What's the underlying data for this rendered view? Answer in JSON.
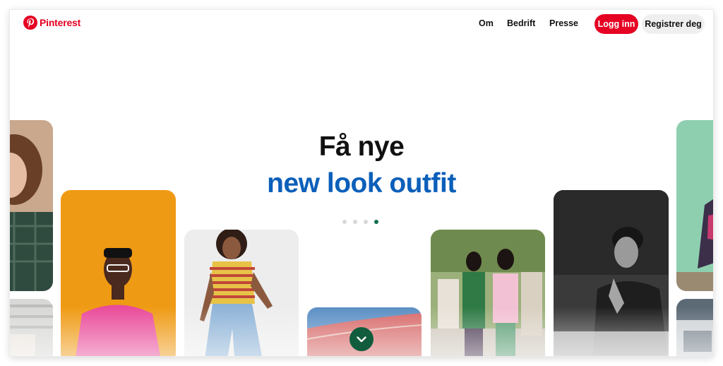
{
  "header": {
    "brand": "Pinterest",
    "nav": [
      "Om",
      "Bedrift",
      "Presse"
    ],
    "login_label": "Logg inn",
    "signup_label": "Registrer deg"
  },
  "hero": {
    "line1": "Få nye",
    "line2": "new look outfit"
  },
  "carousel": {
    "dot_count": 4,
    "active_index": 3
  },
  "colors": {
    "brand_red": "#e60023",
    "hero_blue": "#0b5fba",
    "accent_green": "#115c3d"
  },
  "icons": {
    "logo": "pinterest-logo-icon",
    "scroll": "chevron-down-icon"
  }
}
